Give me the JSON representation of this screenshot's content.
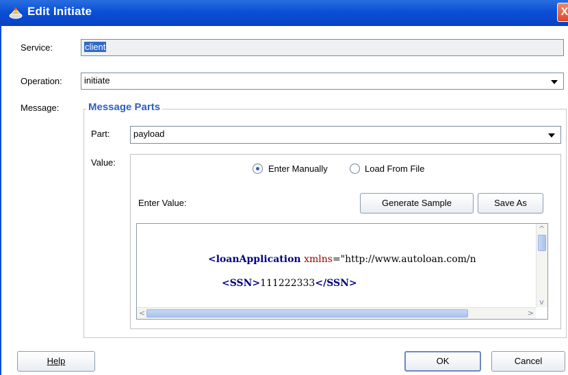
{
  "window": {
    "title": "Edit Initiate",
    "close_glyph": "X"
  },
  "form": {
    "service_label": "Service:",
    "service_value": "client",
    "operation_label": "Operation:",
    "operation_value": "initiate",
    "message_label": "Message:"
  },
  "message_parts": {
    "title": "Message Parts",
    "part_label": "Part:",
    "part_value": "payload",
    "value_label": "Value:",
    "radio_manual": "Enter Manually",
    "radio_file": "Load From File",
    "radio_selected": "Enter Manually",
    "enter_value_label": "Enter Value:",
    "generate_sample": "Generate Sample",
    "save_as": "Save As"
  },
  "editor": {
    "line1_tag": "<loanApplication",
    "line1_attr": " xmlns",
    "line1_rest": "=\"http://www.autoloan.com/n",
    "line2_open": "<SSN>",
    "line2_value": "111222333",
    "line2_close": "</SSN>"
  },
  "footer": {
    "help_label": "Help",
    "ok_label": "OK",
    "cancel_label": "Cancel"
  },
  "icons": [
    "window-icon",
    "close-icon",
    "dropdown-arrow-icon",
    "scroll-up-icon",
    "scroll-down-icon",
    "scroll-left-icon",
    "scroll-right-icon"
  ]
}
